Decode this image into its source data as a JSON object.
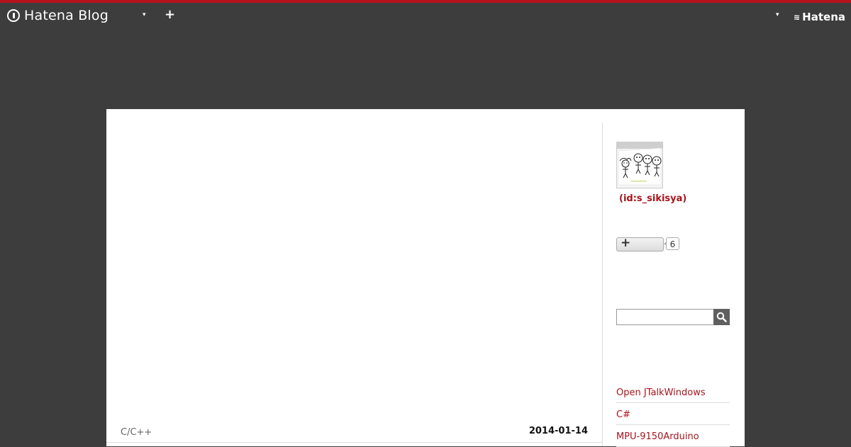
{
  "header": {
    "logo_text": "Hatena Blog",
    "brand_text": "Hatena",
    "plus_glyph": "+",
    "caret_glyph": "▾",
    "accent_color": "#b5121b",
    "background_color": "#3d3d3d"
  },
  "entry": {
    "category": "C/C++",
    "date": "2014-01-14"
  },
  "sidebar": {
    "profile_id": "(id:s_sikisya)",
    "subscribe": {
      "icon": "plus-icon",
      "count": "6"
    },
    "search": {
      "placeholder": "",
      "icon": "search-icon"
    },
    "recent_entries": [
      {
        "title": "Open JTalkWindows"
      },
      {
        "title": "C#"
      },
      {
        "title": "MPU-9150Arduino"
      }
    ],
    "link_color": "#a8141c"
  }
}
